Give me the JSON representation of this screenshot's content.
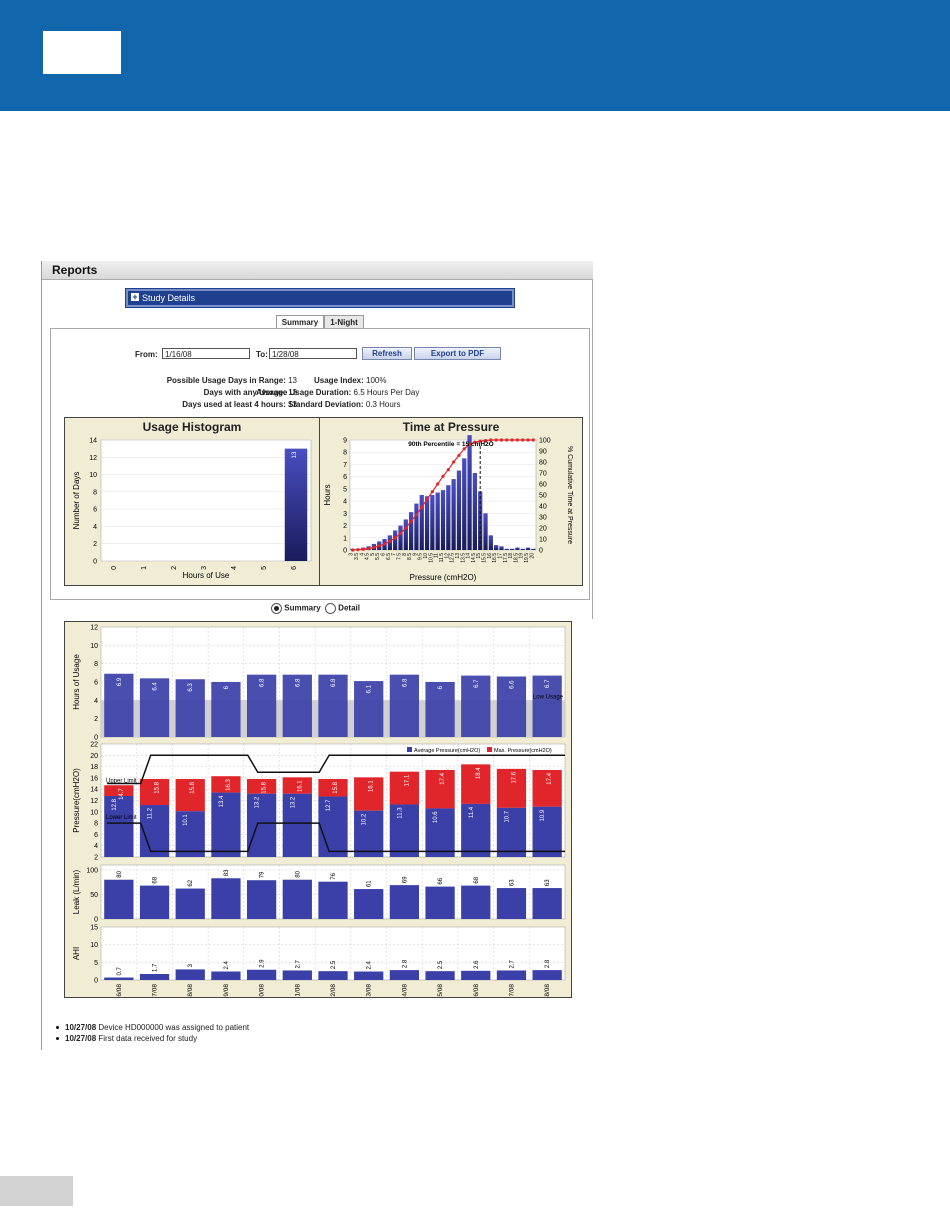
{
  "page": {
    "reports_title": "Reports",
    "study_details_label": "Study Details",
    "tabs": [
      "Summary",
      "1-Night"
    ],
    "active_tab": "Summary"
  },
  "range": {
    "from_label": "From:",
    "from_value": "1/16/08",
    "to_label": "To:",
    "to_value": "1/28/08",
    "refresh_label": "Refresh",
    "export_label": "Export to PDF"
  },
  "stats": {
    "left": [
      {
        "label": "Possible Usage Days in Range:",
        "value": "13"
      },
      {
        "label": "Days with any Usage:",
        "value": "13"
      },
      {
        "label": "Days used at least 4 hours:",
        "value": "13"
      }
    ],
    "right": [
      {
        "label": "Usage Index:",
        "value": "100%"
      },
      {
        "label": "Average Usage Duration:",
        "value": "6.5 Hours Per Day"
      },
      {
        "label": "Standard Deviation:",
        "value": "0.3 Hours"
      }
    ]
  },
  "view_modes": {
    "summary": "Summary",
    "detail": "Detail",
    "selected": "Summary"
  },
  "events": [
    {
      "date": "10/27/08",
      "text": "Device HD000000 was assigned to patient"
    },
    {
      "date": "10/27/08",
      "text": "First data received for study"
    }
  ],
  "colors": {
    "blue": "#3b3fa8",
    "red": "#e0262b",
    "panel": "#f0edd4",
    "banner": "#1266ab"
  },
  "chart_data": [
    {
      "type": "bar",
      "title": "Usage Histogram",
      "xlabel": "Hours of Use",
      "ylabel": "Number of Days",
      "categories": [
        "0",
        "1",
        "2",
        "3",
        "4",
        "5",
        "6"
      ],
      "values": [
        0,
        0,
        0,
        0,
        0,
        0,
        13
      ],
      "data_labels": [
        "",
        "",
        "",
        "",
        "",
        "",
        "13"
      ],
      "yticks": [
        "0",
        "2",
        "4",
        "6",
        "8",
        "10",
        "12",
        "14"
      ],
      "ylim": [
        0,
        14
      ]
    },
    {
      "type": "bar",
      "title": "Time at Pressure",
      "annotation": "90th Percentile = 15 cmH2O",
      "xlabel": "Pressure (cmH2O)",
      "ylabel": "Hours",
      "y2label": "% Cumulative Time at Pressure",
      "categories": [
        "3",
        "3.5",
        "4",
        "4.5",
        "5",
        "5.5",
        "6",
        "6.5",
        "7",
        "7.5",
        "8",
        "8.5",
        "9",
        "9.5",
        "10",
        "10.5",
        "11",
        "11.5",
        "12",
        "12.5",
        "13",
        "13.5",
        "14",
        "14.5",
        "15",
        "15.5",
        "16",
        "16.5",
        "17",
        "17.5",
        "18",
        "18.5",
        "19",
        "19.5",
        "20"
      ],
      "values": [
        0.1,
        0.1,
        0.2,
        0.3,
        0.5,
        0.7,
        0.9,
        1.2,
        1.6,
        2.0,
        2.5,
        3.1,
        3.8,
        4.5,
        4.4,
        4.5,
        4.7,
        4.9,
        5.3,
        5.8,
        6.5,
        7.5,
        9.4,
        6.3,
        4.8,
        3.0,
        1.2,
        0.4,
        0.3,
        0.1,
        0.1,
        0.2,
        0.1,
        0.2,
        0.1
      ],
      "cumulative": [
        0,
        0.3,
        0.7,
        1.3,
        2.3,
        3.7,
        5.5,
        8,
        11,
        15,
        20,
        26,
        32,
        39,
        46,
        53,
        60,
        67,
        73,
        80,
        86,
        92,
        96,
        98,
        99,
        99.5,
        100,
        100,
        100,
        100,
        100,
        100,
        100,
        100,
        100
      ],
      "yticks": [
        "0",
        "1",
        "2",
        "3",
        "4",
        "5",
        "6",
        "7",
        "8",
        "9"
      ],
      "y2ticks": [
        "0",
        "10",
        "20",
        "30",
        "40",
        "50",
        "60",
        "70",
        "80",
        "90",
        "100"
      ],
      "ylim": [
        0,
        9
      ],
      "y2lim": [
        0,
        100
      ],
      "percentile_x": 15
    },
    {
      "type": "bar",
      "ylabel": "Hours of Usage",
      "categories": [
        "1/16/08",
        "1/17/08",
        "1/18/08",
        "1/19/08",
        "1/20/08",
        "1/21/08",
        "1/22/08",
        "1/23/08",
        "1/24/08",
        "1/25/08",
        "1/26/08",
        "1/27/08",
        "1/28/08"
      ],
      "values": [
        6.9,
        6.4,
        6.3,
        6,
        6.8,
        6.8,
        6.8,
        6.1,
        6.8,
        6,
        6.7,
        6.6,
        6.7
      ],
      "data_labels": [
        "6.9",
        "6.4",
        "6.3",
        "6",
        "6.8",
        "6.8",
        "6.8",
        "6.1",
        "6.8",
        "6",
        "6.7",
        "6.6",
        "6.7"
      ],
      "threshold": 4,
      "threshold_label": "Low Usage",
      "yticks": [
        "0",
        "2",
        "4",
        "6",
        "8",
        "10",
        "12"
      ],
      "ylim": [
        0,
        12
      ]
    },
    {
      "type": "bar",
      "ylabel": "Pressure(cmH2O)",
      "categories": [
        "1/16/08",
        "1/17/08",
        "1/18/08",
        "1/19/08",
        "1/20/08",
        "1/21/08",
        "1/22/08",
        "1/23/08",
        "1/24/08",
        "1/25/08",
        "1/26/08",
        "1/27/08",
        "1/28/08"
      ],
      "series": [
        {
          "name": "Average Pressure(cmH2O)",
          "values": [
            12.8,
            11.2,
            10.1,
            13.4,
            13.2,
            13.2,
            12.7,
            10.2,
            11.3,
            10.6,
            11.4,
            10.7,
            10.9
          ]
        },
        {
          "name": "Max. Pressure(cmH2O)",
          "values": [
            14.7,
            15.8,
            15.8,
            16.3,
            15.8,
            16.1,
            15.8,
            16.1,
            17.1,
            17.4,
            18.4,
            17.6,
            17.4
          ]
        }
      ],
      "avg_labels": [
        "12.8",
        "11.2",
        "10.1",
        "13.4",
        "13.2",
        "13.2",
        "12.7",
        "10.2",
        "11.3",
        "10.6",
        "11.4",
        "10.7",
        "10.9"
      ],
      "max_labels": [
        "14.7",
        "15.8",
        "15.8",
        "16.3",
        "15.8",
        "16.1",
        "15.8",
        "16.1",
        "17.1",
        "17.4",
        "18.4",
        "17.6",
        "17.4"
      ],
      "upper_limit": [
        15,
        20,
        20,
        20,
        17,
        17,
        20,
        20,
        20,
        20,
        20,
        20,
        20
      ],
      "lower_limit": [
        8,
        3,
        3,
        3,
        8,
        8,
        3,
        3,
        3,
        3,
        3,
        3,
        3
      ],
      "upper_label": "Upper Limit",
      "lower_label": "Lower Limit",
      "yticks": [
        "2",
        "4",
        "6",
        "8",
        "10",
        "12",
        "14",
        "16",
        "18",
        "20",
        "22"
      ],
      "ylim": [
        2,
        22
      ]
    },
    {
      "type": "bar",
      "ylabel": "Leak (L/min)",
      "categories": [
        "1/16/08",
        "1/17/08",
        "1/18/08",
        "1/19/08",
        "1/20/08",
        "1/21/08",
        "1/22/08",
        "1/23/08",
        "1/24/08",
        "1/25/08",
        "1/26/08",
        "1/27/08",
        "1/28/08"
      ],
      "values": [
        80,
        68,
        62,
        83,
        79,
        80,
        76,
        61,
        69,
        66,
        68,
        63,
        63
      ],
      "data_labels": [
        "80",
        "68",
        "62",
        "83",
        "79",
        "80",
        "76",
        "61",
        "69",
        "66",
        "68",
        "63",
        "63"
      ],
      "yticks": [
        "0",
        "50",
        "100"
      ],
      "ylim": [
        0,
        110
      ]
    },
    {
      "type": "bar",
      "ylabel": "AHI",
      "categories": [
        "1/16/08",
        "1/17/08",
        "1/18/08",
        "1/19/08",
        "1/20/08",
        "1/21/08",
        "1/22/08",
        "1/23/08",
        "1/24/08",
        "1/25/08",
        "1/26/08",
        "1/27/08",
        "1/28/08"
      ],
      "values": [
        0.7,
        1.7,
        3,
        2.4,
        2.9,
        2.7,
        2.5,
        2.4,
        2.8,
        2.5,
        2.6,
        2.7,
        2.8
      ],
      "data_labels": [
        "0.7",
        "1.7",
        "3",
        "2.4",
        "2.9",
        "2.7",
        "2.5",
        "2.4",
        "2.8",
        "2.5",
        "2.6",
        "2.7",
        "2.8"
      ],
      "yticks": [
        "0",
        "5",
        "10",
        "15"
      ],
      "ylim": [
        0,
        15
      ]
    }
  ]
}
